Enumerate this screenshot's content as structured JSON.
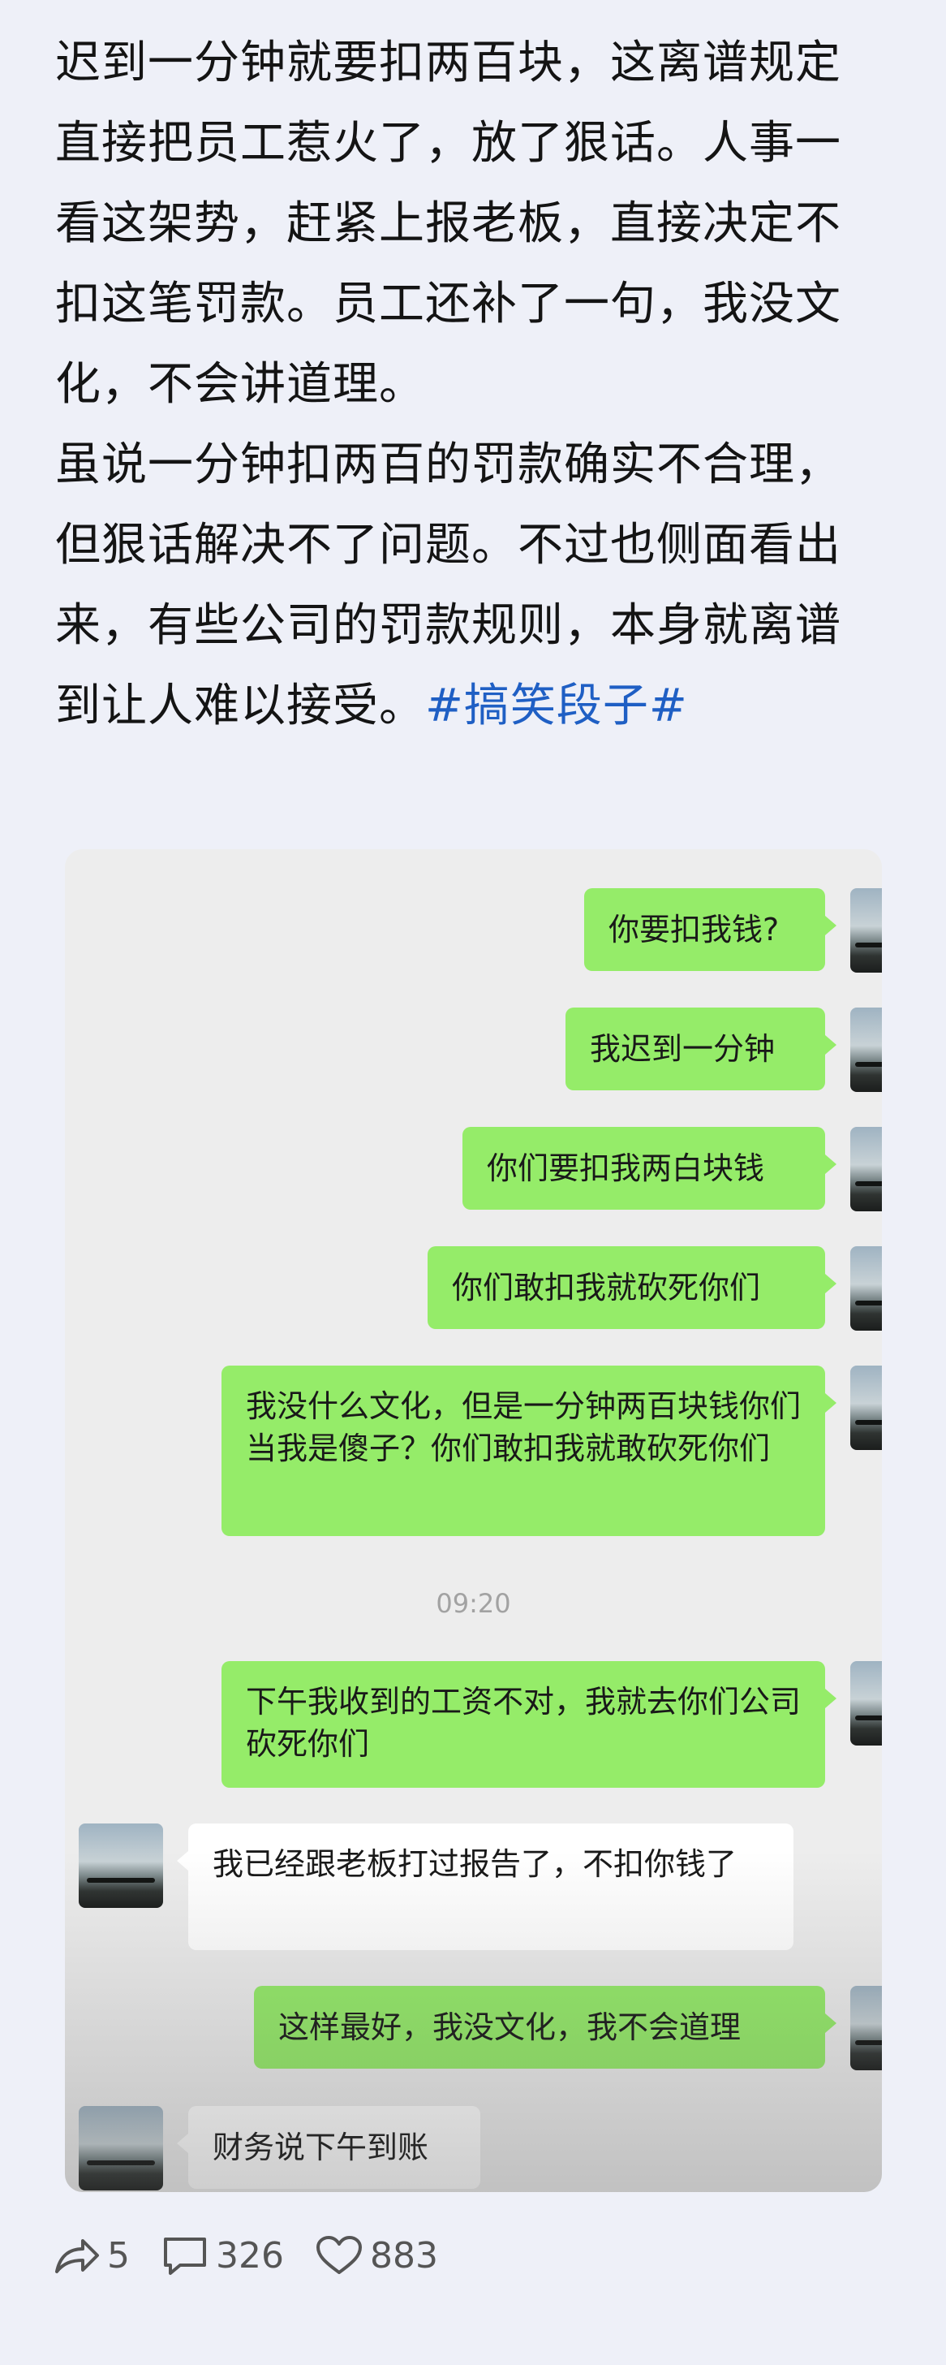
{
  "post": {
    "text": "迟到一分钟就要扣两百块，这离谱规定直接把员工惹火了，放了狠话。人事一看这架势，赶紧上报老板，直接决定不扣这笔罚款。员工还补了一句，我没文化，不会讲道理。",
    "text2": "虽说一分钟扣两百的罚款确实不合理，但狠话解决不了问题。不过也侧面看出来，有些公司的罚款规则，本身就离谱到让人难以接受。",
    "hashtag": "#搞笑段子#"
  },
  "chat": {
    "time_label": "09:20",
    "messages": [
      {
        "sender": "me",
        "text": "你要扣我钱?"
      },
      {
        "sender": "me",
        "text": "我迟到一分钟"
      },
      {
        "sender": "me",
        "text": "你们要扣我两白块钱"
      },
      {
        "sender": "me",
        "text": "你们敢扣我就砍死你们"
      },
      {
        "sender": "me",
        "text": "我没什么文化，但是一分钟两百块钱你们当我是傻子？你们敢扣我就敢砍死你们"
      },
      {
        "sender": "me",
        "text": "下午我收到的工资不对，我就去你们公司砍死你们"
      },
      {
        "sender": "them",
        "text": "我已经跟老板打过报告了，不扣你钱了"
      },
      {
        "sender": "me",
        "text": "这样最好，我没文化，我不会道理"
      },
      {
        "sender": "them",
        "text": "财务说下午到账"
      }
    ]
  },
  "actions": {
    "share_icon": "share-icon",
    "share_count": "5",
    "comment_icon": "comment-icon",
    "comment_count": "326",
    "like_icon": "heart-icon",
    "like_count": "883"
  },
  "colors": {
    "my_bubble": "#95ec69",
    "their_bubble": "#ffffff",
    "hashtag": "#1f5fc4",
    "page_bg": "#eef0f8",
    "chat_bg": "#ededed"
  }
}
